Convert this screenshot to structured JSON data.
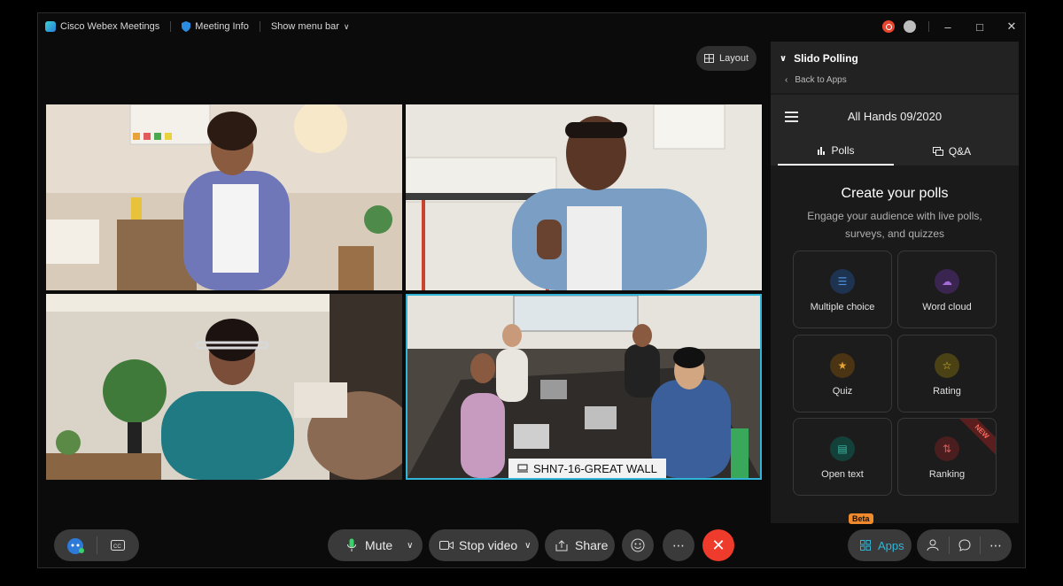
{
  "titlebar": {
    "app_name": "Cisco Webex Meetings",
    "meeting_info": "Meeting Info",
    "show_menu_bar": "Show menu bar"
  },
  "stage": {
    "layout_label": "Layout",
    "highlighted_tile_name": "SHN7-16-GREAT WALL"
  },
  "slido": {
    "panel_title": "Slido Polling",
    "back_label": "Back to Apps",
    "event_title": "All Hands 09/2020",
    "tabs": [
      {
        "label": "Polls"
      },
      {
        "label": "Q&A"
      }
    ],
    "create_title": "Create your polls",
    "create_subtitle": "Engage your audience with live polls, surveys, and quizzes",
    "poll_types": [
      {
        "label": "Multiple choice",
        "icon": "list-icon",
        "color": "#4a8fd8"
      },
      {
        "label": "Word cloud",
        "icon": "cloud-icon",
        "color": "#a46ad8"
      },
      {
        "label": "Quiz",
        "icon": "trophy-icon",
        "color": "#e4a634"
      },
      {
        "label": "Rating",
        "icon": "star-icon",
        "color": "#e4c434"
      },
      {
        "label": "Open text",
        "icon": "chat-icon",
        "color": "#3ab9a4"
      },
      {
        "label": "Ranking",
        "icon": "sort-icon",
        "color": "#e05a5a",
        "badge": "NEW"
      }
    ]
  },
  "controls": {
    "mute_label": "Mute",
    "stop_video_label": "Stop video",
    "share_label": "Share",
    "apps_label": "Apps",
    "apps_badge": "Beta",
    "accent": "#30b5d8",
    "end_color": "#ee3b2b"
  }
}
